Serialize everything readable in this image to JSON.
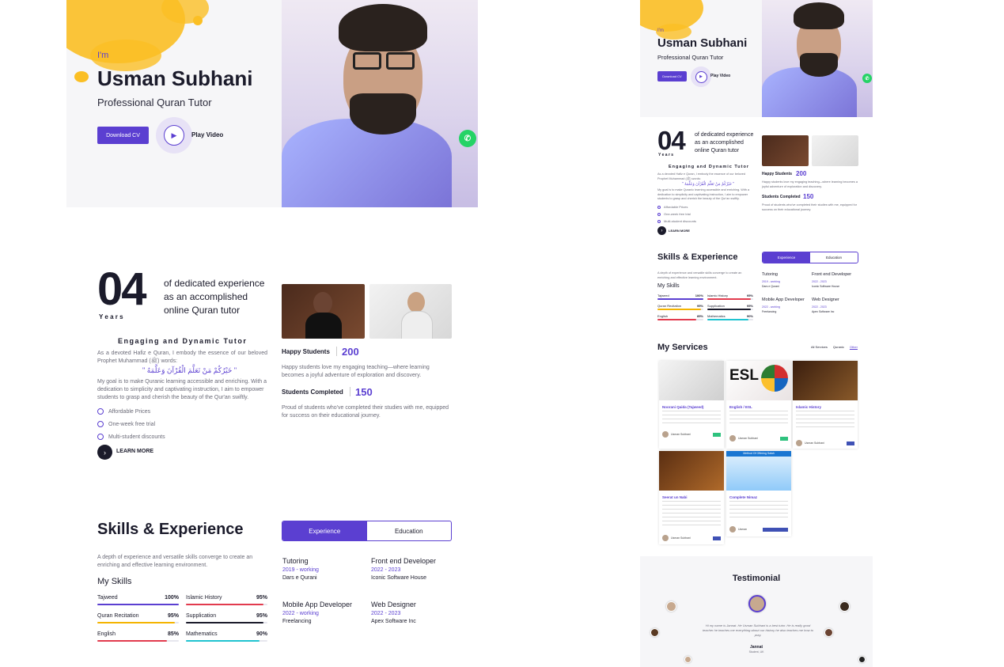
{
  "hero": {
    "intro": "I'm",
    "name": "Usman Subhani",
    "role": "Professional Quran Tutor",
    "download_label": "Download CV",
    "play_label": "Play Video"
  },
  "about": {
    "years_number": "04",
    "years_label": "Y e a r s",
    "headline_line1": "of dedicated experience",
    "headline_line2": "as an accomplished",
    "headline_line3": "online Quran tutor",
    "subtitle": "Engaging and Dynamic Tutor",
    "para1": "As a devoted Hafiz e Quran, I embody the essence of our beloved Prophet Muhammad (ﷺ) words:",
    "arabic": "\" خَيْرُكُمْ مَنْ تَعَلَّمَ الْقُرْآنَ وَعَلَّمَهُ \"",
    "para2": "My goal is to make Quranic learning accessible and enriching. With a dedication to simplicity and captivating instruction, I aim to empower students to grasp and cherish the beauty of the Qur'an swiftly.",
    "features": [
      "Affordable Prices",
      "One-week free trial",
      "Multi-student discounts"
    ],
    "learn_more": "LEARN MORE",
    "happy_label": "Happy Students",
    "happy_value": "200",
    "happy_desc": "Happy students love my engaging teaching—where learning becomes a joyful adventure of exploration and discovery.",
    "completed_label": "Students Completed",
    "completed_value": "150",
    "completed_desc": "Proud of students who've completed their studies with me, equipped for success on their educational journey."
  },
  "skills": {
    "title": "Skills & Experience",
    "tab_experience": "Experience",
    "tab_education": "Education",
    "desc": "A depth of experience and versatile skills converge to create an enriching and effective learning environment.",
    "my_skills": "My Skills",
    "items": [
      {
        "name": "Tajweed",
        "pct": "100%",
        "value": 1.0,
        "color": "#5b3fd1"
      },
      {
        "name": "Islamic History",
        "pct": "95%",
        "value": 0.95,
        "color": "#e23b4e"
      },
      {
        "name": "Quran Recitation",
        "pct": "95%",
        "value": 0.95,
        "color": "#f4b400"
      },
      {
        "name": "Supplication",
        "pct": "95%",
        "value": 0.95,
        "color": "#1b1b2b"
      },
      {
        "name": "English",
        "pct": "85%",
        "value": 0.85,
        "color": "#e23b4e"
      },
      {
        "name": "Mathematics",
        "pct": "90%",
        "value": 0.9,
        "color": "#20c3d0"
      }
    ],
    "experience": [
      {
        "role": "Tutoring",
        "years": "2019 - working",
        "org": "Dars e Qurani"
      },
      {
        "role": "Front end Developer",
        "years": "2022 - 2023",
        "org": "Iconic Software House"
      },
      {
        "role": "Mobile App Developer",
        "years": "2022 - working",
        "org": "Freelancing"
      },
      {
        "role": "Web Designer",
        "years": "2022 - 2023",
        "org": "Apex Software Inc"
      }
    ]
  },
  "services": {
    "title": "My Services",
    "filters": [
      "All Services",
      "Quranic",
      "Other"
    ],
    "cards": [
      {
        "title": "Noorani Qaida (Tajweed)",
        "author": "Usman Subhani",
        "tag_color": "#2ec27e"
      },
      {
        "title": "English / ESL",
        "author": "Usman Subhani",
        "tag_color": "#2ec27e"
      },
      {
        "title": "Islamic History",
        "author": "Usman Subhani",
        "tag_color": "#3f51b5"
      },
      {
        "title": "Seerat un Nabi",
        "author": "Usman Subhani",
        "tag_color": "#3f51b5"
      },
      {
        "title": "Complete Nimaz",
        "author": "Usman",
        "tag_color": "#3f51b5"
      }
    ],
    "esl_label": "ESL",
    "nimaz_banner": "Method Of Offering Salah"
  },
  "testimonial": {
    "title": "Testimonial",
    "quote": "Hi my name is Jannat. He Usman Subhani is a best tutor. He is really good teacher he teaches me everything about our history he also teaches me how to pray.",
    "author": "Jannat",
    "author_loc": "Student, UK"
  },
  "colors": {
    "accent": "#5b3fd1",
    "whatsapp": "#25d366"
  }
}
